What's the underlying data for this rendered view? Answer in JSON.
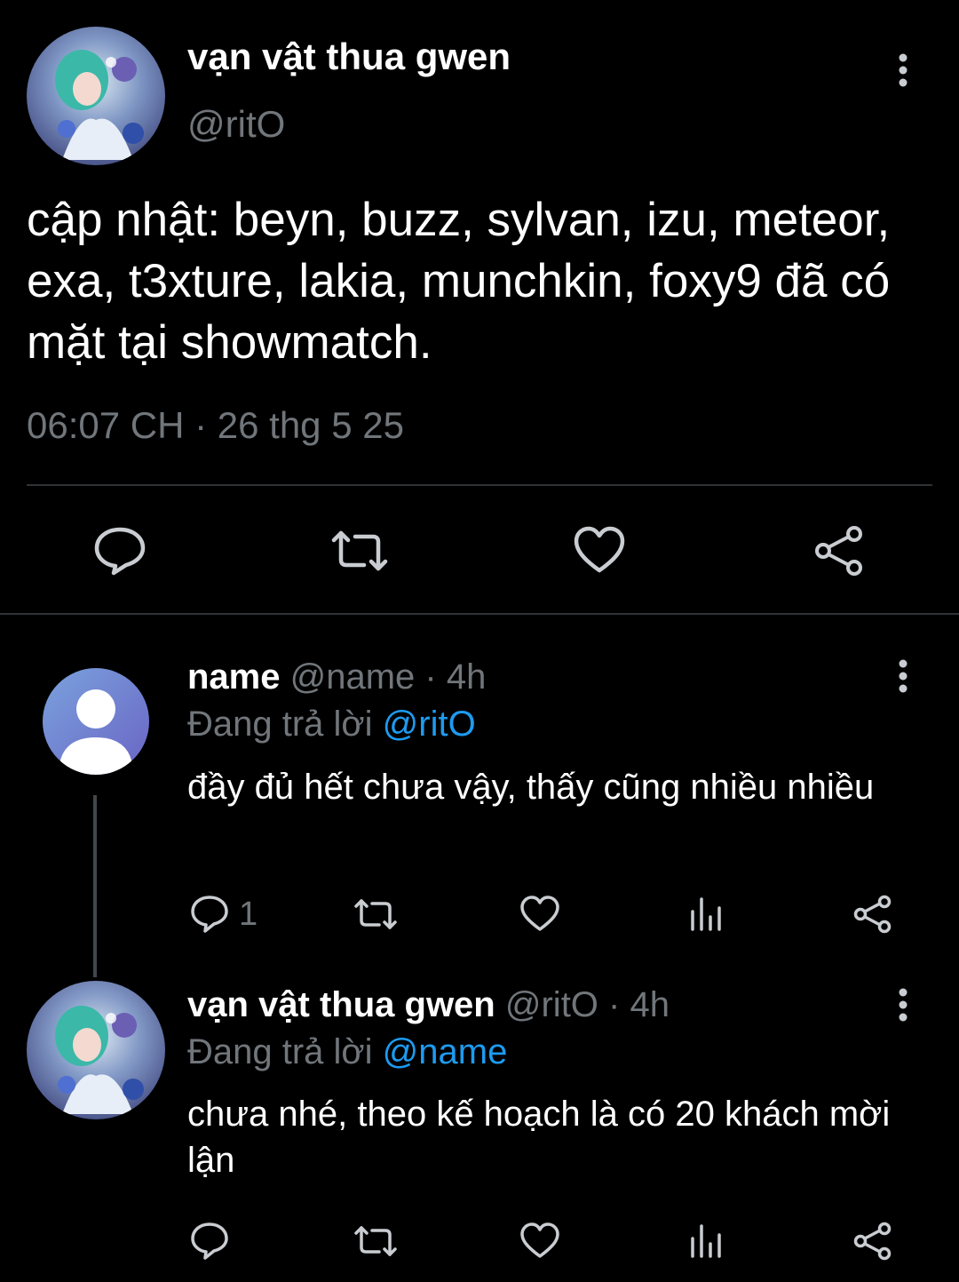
{
  "tweet": {
    "author_name": "vạn vật thua gwen",
    "author_handle": "@ritO",
    "text": "cập nhật: beyn, buzz, sylvan, izu, meteor, exa, t3xture, lakia, munchkin, foxy9 đã có mặt tại showmatch.",
    "timestamp": "06:07 CH · 26 thg 5 25"
  },
  "replies": [
    {
      "name": "name",
      "handle": "@name",
      "time_sep": " · ",
      "time": "4h",
      "replying_prefix": "Đang trả lời ",
      "replying_to": "@ritO",
      "text": "đầy đủ hết chưa vậy, thấy cũng nhiều nhiều",
      "reply_count": "1"
    },
    {
      "name": "vạn vật thua gwen",
      "handle": "@ritO",
      "time_sep": " · ",
      "time": "4h",
      "replying_prefix": "Đang trả lời ",
      "replying_to": "@name",
      "text": "chưa nhé, theo kế hoạch là có 20 khách mời lận",
      "reply_count": ""
    }
  ],
  "colors": {
    "background": "#000000",
    "text_primary": "#ffffff",
    "text_secondary": "#71767b",
    "link": "#1d9bf0",
    "divider": "#2f3336"
  },
  "icons": {
    "more": "more-vertical-icon",
    "reply": "reply-bubble-icon",
    "retweet": "retweet-icon",
    "like": "heart-icon",
    "views": "views-chart-icon",
    "share": "share-icon",
    "default_avatar": "default-user-icon"
  }
}
